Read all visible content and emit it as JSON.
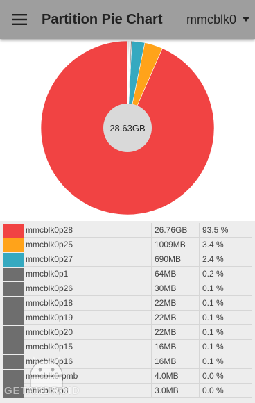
{
  "header": {
    "title": "Partition Pie Chart",
    "device": "mmcblk0",
    "menu_icon": "hamburger-menu-icon",
    "dropdown_icon": "caret-down-icon"
  },
  "chart_data": {
    "type": "pie",
    "center_label": "28.63GB",
    "categories": [
      "mmcblk0p28",
      "mmcblk0p25",
      "mmcblk0p27",
      "mmcblk0p1",
      "mmcblk0p26",
      "mmcblk0p18",
      "mmcblk0p19",
      "mmcblk0p20",
      "mmcblk0p15",
      "mmcblk0p16",
      "mmcblk0rpmb",
      "mmcblk0p3"
    ],
    "values": [
      93.5,
      3.4,
      2.4,
      0.2,
      0.1,
      0.1,
      0.1,
      0.1,
      0.1,
      0.1,
      0.0,
      0.0
    ],
    "colors": [
      "#f14343",
      "#ffa31a",
      "#35a9c0",
      "#6e6e6e",
      "#6e6e6e",
      "#6e6e6e",
      "#6e6e6e",
      "#6e6e6e",
      "#6e6e6e",
      "#6e6e6e",
      "#6e6e6e",
      "#6e6e6e"
    ],
    "start_angle_deg": 0,
    "direction": "counterclockwise"
  },
  "table": {
    "rows": [
      {
        "name": "mmcblk0p28",
        "size": "26.76GB",
        "pct": "93.5 %",
        "color": "#f14343"
      },
      {
        "name": "mmcblk0p25",
        "size": "1009MB",
        "pct": "3.4 %",
        "color": "#ffa31a"
      },
      {
        "name": "mmcblk0p27",
        "size": "690MB",
        "pct": "2.4 %",
        "color": "#35a9c0"
      },
      {
        "name": "mmcblk0p1",
        "size": "64MB",
        "pct": "0.2 %",
        "color": "#6e6e6e"
      },
      {
        "name": "mmcblk0p26",
        "size": "30MB",
        "pct": "0.1 %",
        "color": "#6e6e6e"
      },
      {
        "name": "mmcblk0p18",
        "size": "22MB",
        "pct": "0.1 %",
        "color": "#6e6e6e"
      },
      {
        "name": "mmcblk0p19",
        "size": "22MB",
        "pct": "0.1 %",
        "color": "#6e6e6e"
      },
      {
        "name": "mmcblk0p20",
        "size": "22MB",
        "pct": "0.1 %",
        "color": "#6e6e6e"
      },
      {
        "name": "mmcblk0p15",
        "size": "16MB",
        "pct": "0.1 %",
        "color": "#6e6e6e"
      },
      {
        "name": "mmcblk0p16",
        "size": "16MB",
        "pct": "0.1 %",
        "color": "#6e6e6e"
      },
      {
        "name": "mmcblk0rpmb",
        "size": "4.0MB",
        "pct": "0.0 %",
        "color": "#6e6e6e"
      },
      {
        "name": "mmcblk0p3",
        "size": "3.0MB",
        "pct": "0.0 %",
        "color": "#6e6e6e"
      }
    ]
  },
  "watermark": {
    "text": "GETANDROID",
    "icon": "android-robot-icon"
  }
}
